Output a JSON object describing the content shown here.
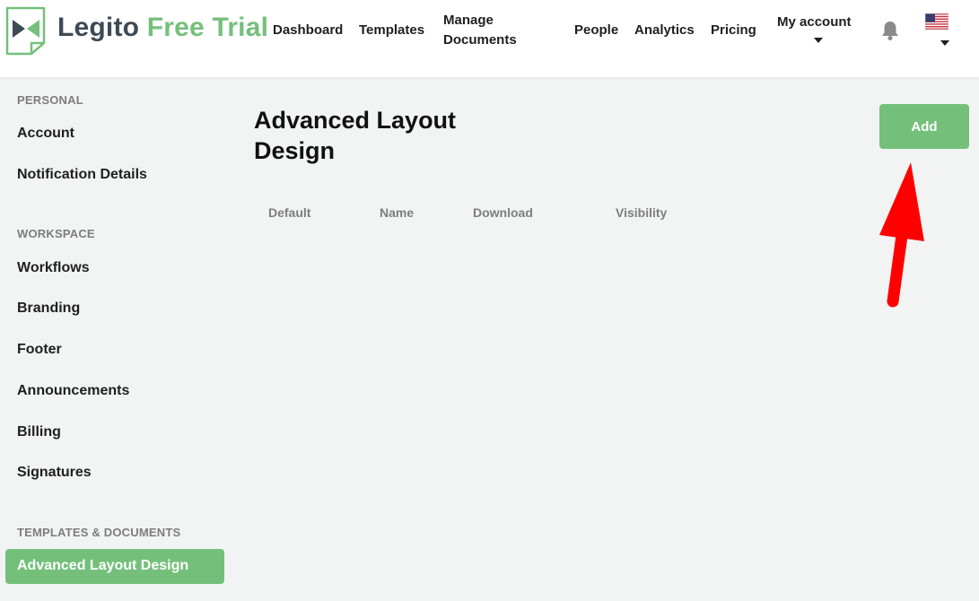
{
  "app": {
    "logo_name": "Legito",
    "logo_trial": "Free Trial"
  },
  "nav": {
    "dashboard": "Dashboard",
    "templates": "Templates",
    "manage_line1": "Manage",
    "manage_line2": "Documents",
    "people": "People",
    "analytics": "Analytics",
    "pricing": "Pricing",
    "my_account": "My account"
  },
  "icons": {
    "logo": "legito-logo-icon",
    "bell": "bell-icon",
    "flag": "us-flag-icon",
    "caret": "caret-down-icon",
    "annotation": "red-arrow-annotation"
  },
  "sidebar": {
    "personal_heading": "PERSONAL",
    "personal_items": [
      "Account",
      "Notification Details"
    ],
    "workspace_heading": "WORKSPACE",
    "workspace_items": [
      "Workflows",
      "Branding",
      "Footer",
      "Announcements",
      "Billing",
      "Signatures"
    ],
    "templates_heading": "TEMPLATES & DOCUMENTS",
    "active_item": "Advanced Layout Design"
  },
  "main": {
    "title": "Advanced Layout Design",
    "columns": [
      "Default",
      "Name",
      "Download",
      "Visibility"
    ],
    "add_label": "Add"
  },
  "colors": {
    "accent_green": "#74c07b",
    "logo_dark": "#3e4a55",
    "annotation_red": "#ff0000",
    "background": "#f2f3f3"
  }
}
